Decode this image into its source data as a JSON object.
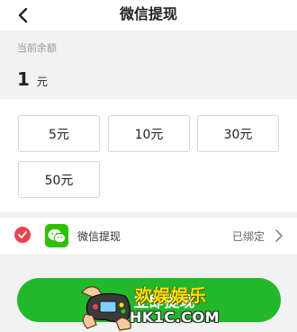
{
  "header": {
    "title": "微信提现",
    "back_icon": "chevron-left-icon"
  },
  "balance": {
    "label": "当前余额",
    "amount": "1",
    "unit": "元"
  },
  "amount_options": [
    {
      "label": "5元"
    },
    {
      "label": "10元"
    },
    {
      "label": "30元"
    },
    {
      "label": "50元"
    }
  ],
  "payment_method": {
    "selected": true,
    "check_icon": "check-circle-icon",
    "icon": "wechat-icon",
    "label": "微信提现",
    "status": "已绑定",
    "arrow_icon": "chevron-right-icon"
  },
  "submit": {
    "label": "立即提现"
  },
  "watermark": {
    "top": "欢娱娱乐",
    "bottom": "HK1C.COM"
  },
  "colors": {
    "accent_green": "#22b82a",
    "wechat_green": "#2dc100",
    "check_red": "#e8434f",
    "background_gray": "#f2f2f2"
  }
}
